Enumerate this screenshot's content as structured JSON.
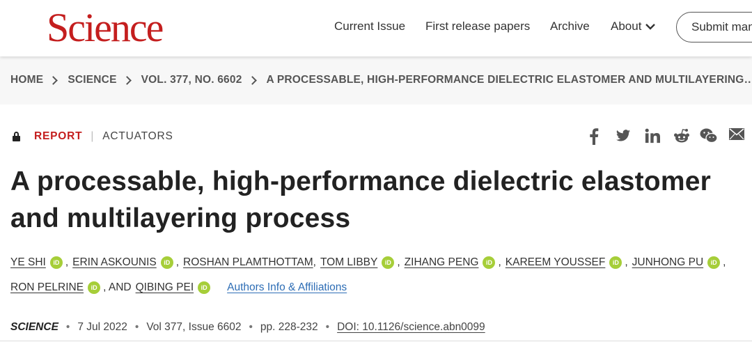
{
  "site": {
    "logo": "Science"
  },
  "nav": {
    "items": [
      "Current Issue",
      "First release papers",
      "Archive",
      "About"
    ],
    "submit_label": "Submit manuscript"
  },
  "breadcrumb": [
    "HOME",
    "SCIENCE",
    "VOL. 377, NO. 6602",
    "A PROCESSABLE, HIGH-PERFORMANCE DIELECTRIC ELASTOMER AND MULTILAYERING…"
  ],
  "article": {
    "type": "REPORT",
    "section": "ACTUATORS",
    "title_line1": "A processable, high-performance dielectric elastomer",
    "title_line2": "and multilayering process",
    "orcid_label": "iD",
    "authors": [
      "YE SHI",
      "ERIN ASKOUNIS",
      "ROSHAN PLAMTHOTTAM",
      "TOM LIBBY",
      "ZIHANG PENG",
      "KAREEM YOUSSEF",
      "JUNHONG PU",
      "RON PELRINE",
      "QIBING PEI"
    ],
    "and_text": ", AND",
    "affiliations_link": "Authors Info & Affiliations",
    "journal": "SCIENCE",
    "date": "7 Jul 2022",
    "volume": "Vol 377, Issue 6602",
    "pages": "pp. 228-232",
    "doi": "DOI: 10.1126/science.abn0099"
  },
  "share_icons": [
    "facebook-icon",
    "twitter-icon",
    "linkedin-icon",
    "reddit-icon",
    "wechat-icon",
    "email-icon"
  ],
  "colors": {
    "brand": "#c41e1e",
    "orcid": "#a6ce39",
    "link": "#2d6db5"
  }
}
